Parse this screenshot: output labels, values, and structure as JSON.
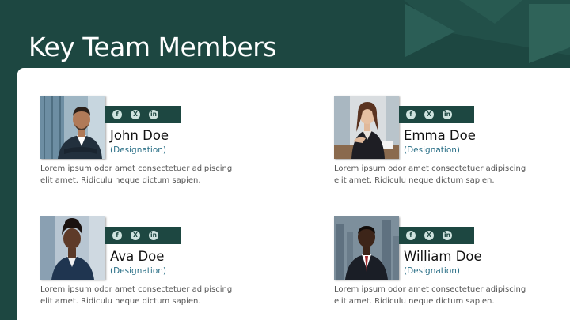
{
  "slide": {
    "title": "Key Team Members"
  },
  "social_icons": [
    "facebook-icon",
    "x-twitter-icon",
    "linkedin-icon"
  ],
  "social_glyphs": {
    "facebook": "f",
    "x": "X",
    "linkedin": "in"
  },
  "colors": {
    "background": "#1d4741",
    "panel": "#ffffff",
    "social_bar": "#1d4741",
    "designation": "#2a6f86"
  },
  "members": [
    {
      "name": "John Doe",
      "designation": "(Designation)",
      "description": "Lorem ipsum odor amet consectetuer adipiscing elit amet. Ridiculu neque dictum sapien."
    },
    {
      "name": "Emma Doe",
      "designation": "(Designation)",
      "description": "Lorem ipsum odor amet consectetuer adipiscing elit amet. Ridiculu neque dictum sapien."
    },
    {
      "name": "Ava Doe",
      "designation": "(Designation)",
      "description": "Lorem ipsum odor amet consectetuer adipiscing elit amet. Ridiculu neque dictum sapien."
    },
    {
      "name": "William Doe",
      "designation": "(Designation)",
      "description": "Lorem ipsum odor amet consectetuer adipiscing elit amet. Ridiculu neque dictum sapien."
    }
  ]
}
